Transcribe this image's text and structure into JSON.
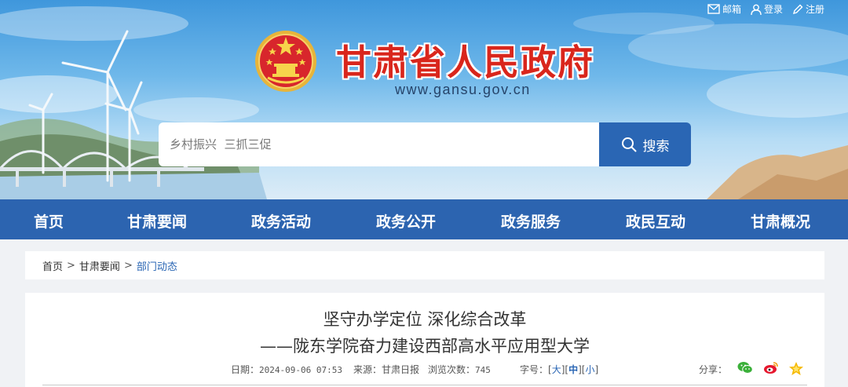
{
  "top_links": {
    "mail": "邮箱",
    "login": "登录",
    "register": "注册"
  },
  "header": {
    "title": "甘肃省人民政府",
    "url": "www.gansu.gov.cn"
  },
  "search": {
    "placeholder": "乡村振兴  三抓三促",
    "button": "搜索"
  },
  "nav": [
    "首页",
    "甘肃要闻",
    "政务活动",
    "政务公开",
    "政务服务",
    "政民互动",
    "甘肃概况"
  ],
  "breadcrumb": {
    "home": "首页",
    "sep": ">",
    "section": "甘肃要闻",
    "current": "部门动态"
  },
  "article": {
    "title_line1": "坚守办学定位 深化综合改革",
    "title_line2": "——陇东学院奋力建设西部高水平应用型大学",
    "date_label": "日期：",
    "date": "2024-09-06 07:53",
    "source_label": "来源：",
    "source": "甘肃日报",
    "views_label": "浏览次数：",
    "views": "745",
    "fontsize_label": "字号：",
    "fontsize_large": "大",
    "fontsize_medium": "中",
    "fontsize_small": "小",
    "share_label": "分享："
  },
  "colors": {
    "nav_bg": "#2c64b0",
    "title_red": "#d9261c",
    "link_blue": "#2a66b4"
  },
  "icons": [
    "mail-icon",
    "user-icon",
    "edit-icon",
    "search-icon",
    "wechat-icon",
    "weibo-icon",
    "favorite-icon",
    "national-emblem"
  ]
}
